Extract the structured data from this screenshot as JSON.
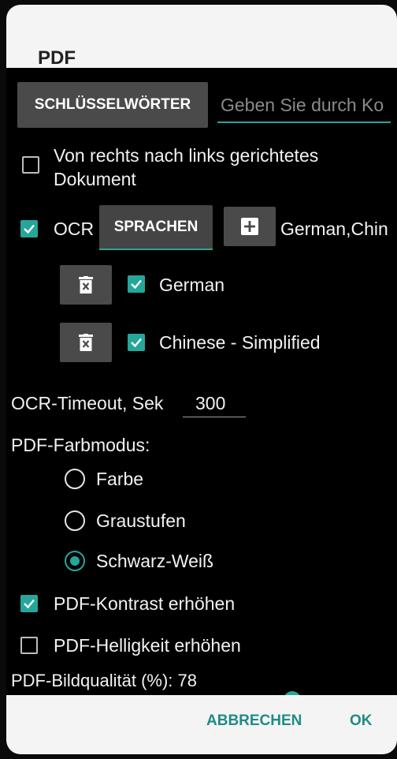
{
  "dialog": {
    "title": "PDF"
  },
  "keywords": {
    "button_label": "SCHLÜSSELWÖRTER",
    "input_placeholder": "Geben Sie durch Ko"
  },
  "rtl": {
    "label_line1": "Von rechts nach links gerichtetes",
    "label_line2": "Dokument",
    "checked": false
  },
  "ocr": {
    "label": "OCR",
    "checked": true,
    "languages_button": "SPRACHEN",
    "selected_languages": "German,Chin",
    "languages": [
      {
        "name": "German",
        "checked": true
      },
      {
        "name": "Chinese - Simplified",
        "checked": true
      }
    ]
  },
  "timeout": {
    "label": "OCR-Timeout, Sek",
    "value": "300"
  },
  "color_mode": {
    "label": "PDF-Farbmodus:",
    "options": [
      {
        "label": "Farbe",
        "selected": false
      },
      {
        "label": "Graustufen",
        "selected": false
      },
      {
        "label": "Schwarz-Weiß",
        "selected": true
      }
    ]
  },
  "contrast": {
    "label": "PDF-Kontrast erhöhen",
    "checked": true
  },
  "brightness": {
    "label": "PDF-Helligkeit erhöhen",
    "checked": false
  },
  "quality": {
    "label": "PDF-Bildqualität (%): 78",
    "value": 78
  },
  "footer": {
    "cancel": "ABBRECHEN",
    "ok": "OK"
  },
  "colors": {
    "accent": "#26a69a",
    "button_gray": "#4a4a4a",
    "background": "#000000"
  }
}
